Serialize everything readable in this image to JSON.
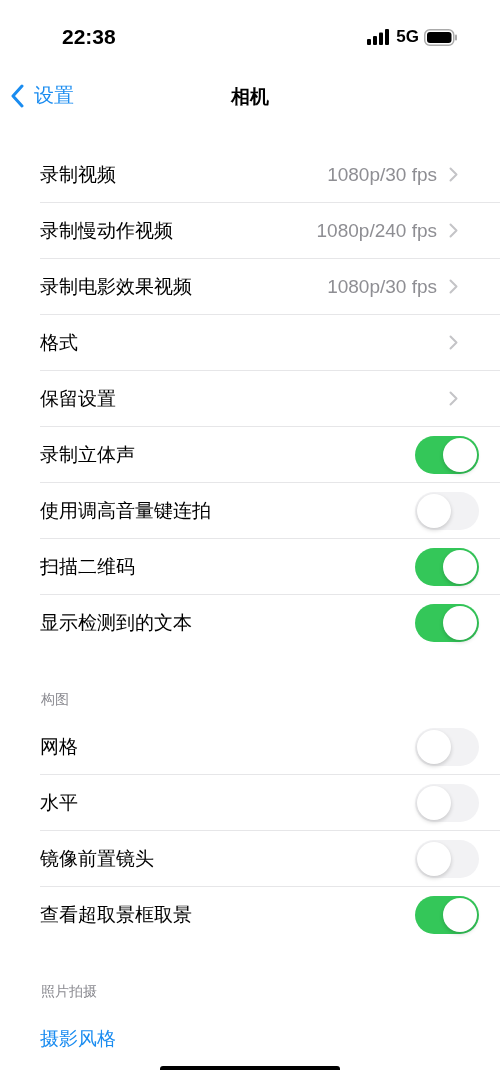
{
  "status_bar": {
    "time": "22:38",
    "network": "5G"
  },
  "nav": {
    "back": "设置",
    "title": "相机"
  },
  "sections": [
    {
      "rows": [
        {
          "kind": "link",
          "label": "录制视频",
          "value": "1080p/30 fps"
        },
        {
          "kind": "link",
          "label": "录制慢动作视频",
          "value": "1080p/240 fps"
        },
        {
          "kind": "link",
          "label": "录制电影效果视频",
          "value": "1080p/30 fps"
        },
        {
          "kind": "link",
          "label": "格式"
        },
        {
          "kind": "link",
          "label": "保留设置"
        },
        {
          "kind": "toggle",
          "label": "录制立体声",
          "on": true
        },
        {
          "kind": "toggle",
          "label": "使用调高音量键连拍",
          "on": false
        },
        {
          "kind": "toggle",
          "label": "扫描二维码",
          "on": true
        },
        {
          "kind": "toggle",
          "label": "显示检测到的文本",
          "on": true
        }
      ]
    },
    {
      "header": "构图",
      "rows": [
        {
          "kind": "toggle",
          "label": "网格",
          "on": false
        },
        {
          "kind": "toggle",
          "label": "水平",
          "on": false
        },
        {
          "kind": "toggle",
          "label": "镜像前置镜头",
          "on": false
        },
        {
          "kind": "toggle",
          "label": "查看超取景框取景",
          "on": true
        }
      ]
    },
    {
      "header": "照片拍摄",
      "rows": [
        {
          "kind": "action",
          "label": "摄影风格"
        }
      ]
    }
  ]
}
